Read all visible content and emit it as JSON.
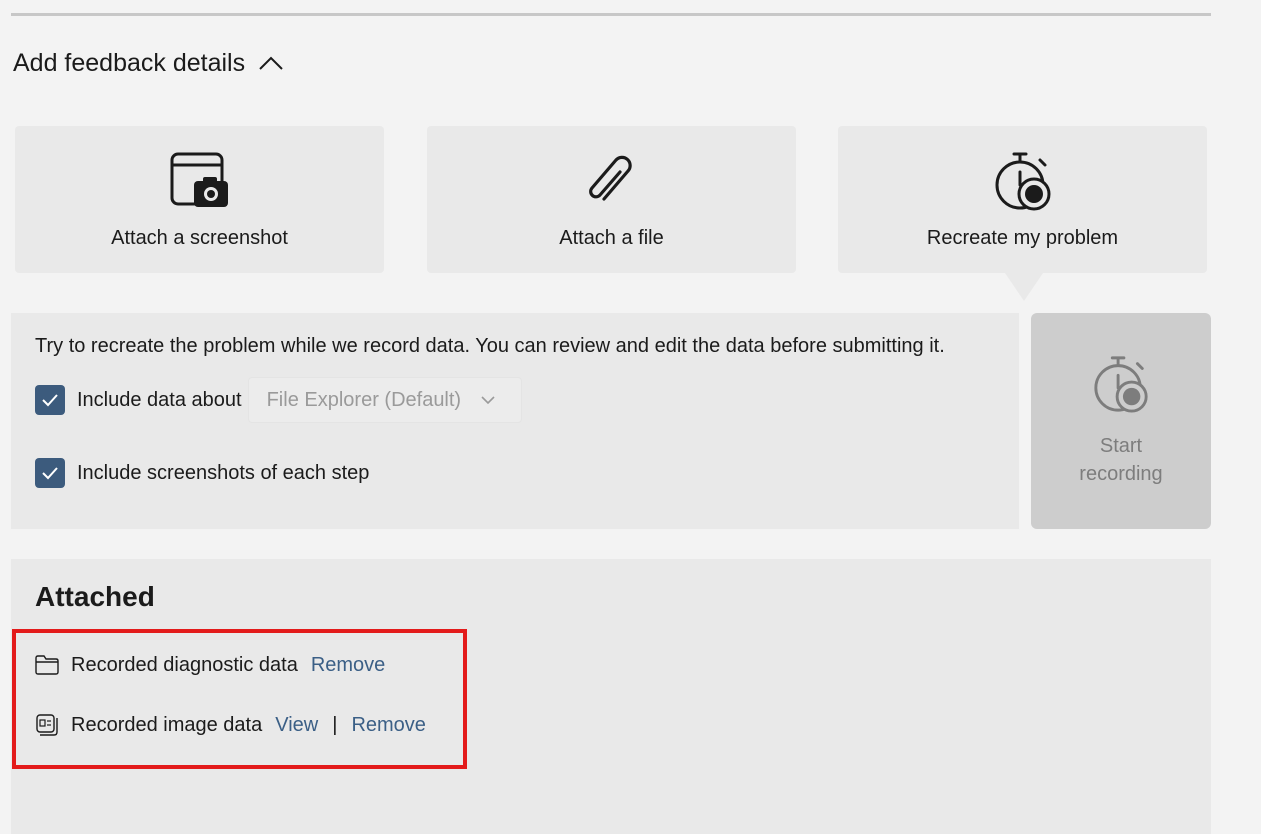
{
  "section": {
    "title": "Add feedback details"
  },
  "cards": [
    {
      "label": "Attach a screenshot",
      "icon": "screenshot-camera-icon"
    },
    {
      "label": "Attach a file",
      "icon": "paperclip-icon"
    },
    {
      "label": "Recreate my problem",
      "icon": "stopwatch-record-icon"
    }
  ],
  "recording": {
    "description": "Try to recreate the problem while we record data. You can review and edit the data before submitting it.",
    "include_data_label": "Include data about",
    "include_data_checked": true,
    "app_dropdown_value": "File Explorer (Default)",
    "include_screenshots_label": "Include screenshots of each step",
    "include_screenshots_checked": true,
    "start_button_label": "Start recording"
  },
  "attached": {
    "title": "Attached",
    "items": [
      {
        "label": "Recorded diagnostic data",
        "icon": "folder-icon",
        "remove_label": "Remove"
      },
      {
        "label": "Recorded image data",
        "icon": "image-data-icon",
        "view_label": "View",
        "separator": "|",
        "remove_label": "Remove"
      }
    ]
  },
  "colors": {
    "checkbox_fill": "#3c5b7d",
    "link": "#3b5f86",
    "highlight": "#e31b1b"
  }
}
